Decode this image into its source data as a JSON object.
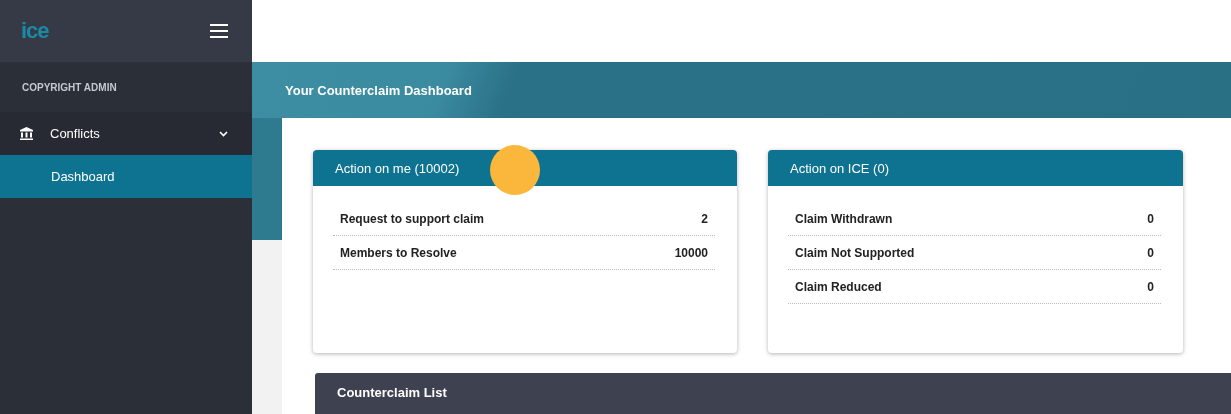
{
  "logo": {
    "text": "ice"
  },
  "sidebar": {
    "section": "COPYRIGHT ADMIN",
    "items": [
      {
        "label": "Conflicts",
        "kind": "group",
        "expanded": true,
        "selected": false
      },
      {
        "label": "Dashboard",
        "kind": "sub",
        "selected": true
      }
    ]
  },
  "page_title": "Your Counterclaim Dashboard",
  "cards": [
    {
      "title": "Action on me (10002)",
      "rows": [
        {
          "label": "Request to support claim",
          "value": "2"
        },
        {
          "label": "Members to Resolve",
          "value": "10000"
        }
      ]
    },
    {
      "title": "Action on ICE (0)",
      "rows": [
        {
          "label": "Claim Withdrawn",
          "value": "0"
        },
        {
          "label": "Claim Not Supported",
          "value": "0"
        },
        {
          "label": "Claim Reduced",
          "value": "0"
        }
      ]
    }
  ],
  "list_panel": {
    "title": "Counterclaim List"
  }
}
